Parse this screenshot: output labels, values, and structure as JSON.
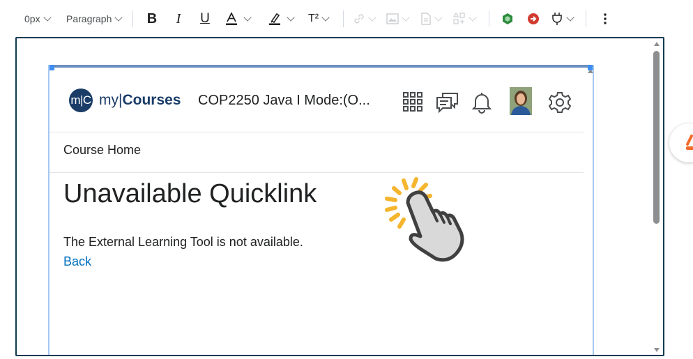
{
  "toolbar": {
    "font_size": "0px",
    "block_format": "Paragraph",
    "superscript_label": "T²"
  },
  "editor": {
    "embedded": {
      "brand_logo": "m|C",
      "brand_prefix": "my|",
      "brand_name": "Courses",
      "course_title": "COP2250 Java I Mode:(O...",
      "breadcrumb": "Course Home",
      "heading": "Unavailable Quicklink",
      "message": "The External Learning Tool is not available.",
      "back_link": "Back"
    }
  },
  "colors": {
    "brand": "#1a3c67",
    "link": "#006fbf",
    "frame_border": "#0e3a52",
    "selection": "#3d8ef0",
    "hand_sparks": "#f5b52e"
  }
}
